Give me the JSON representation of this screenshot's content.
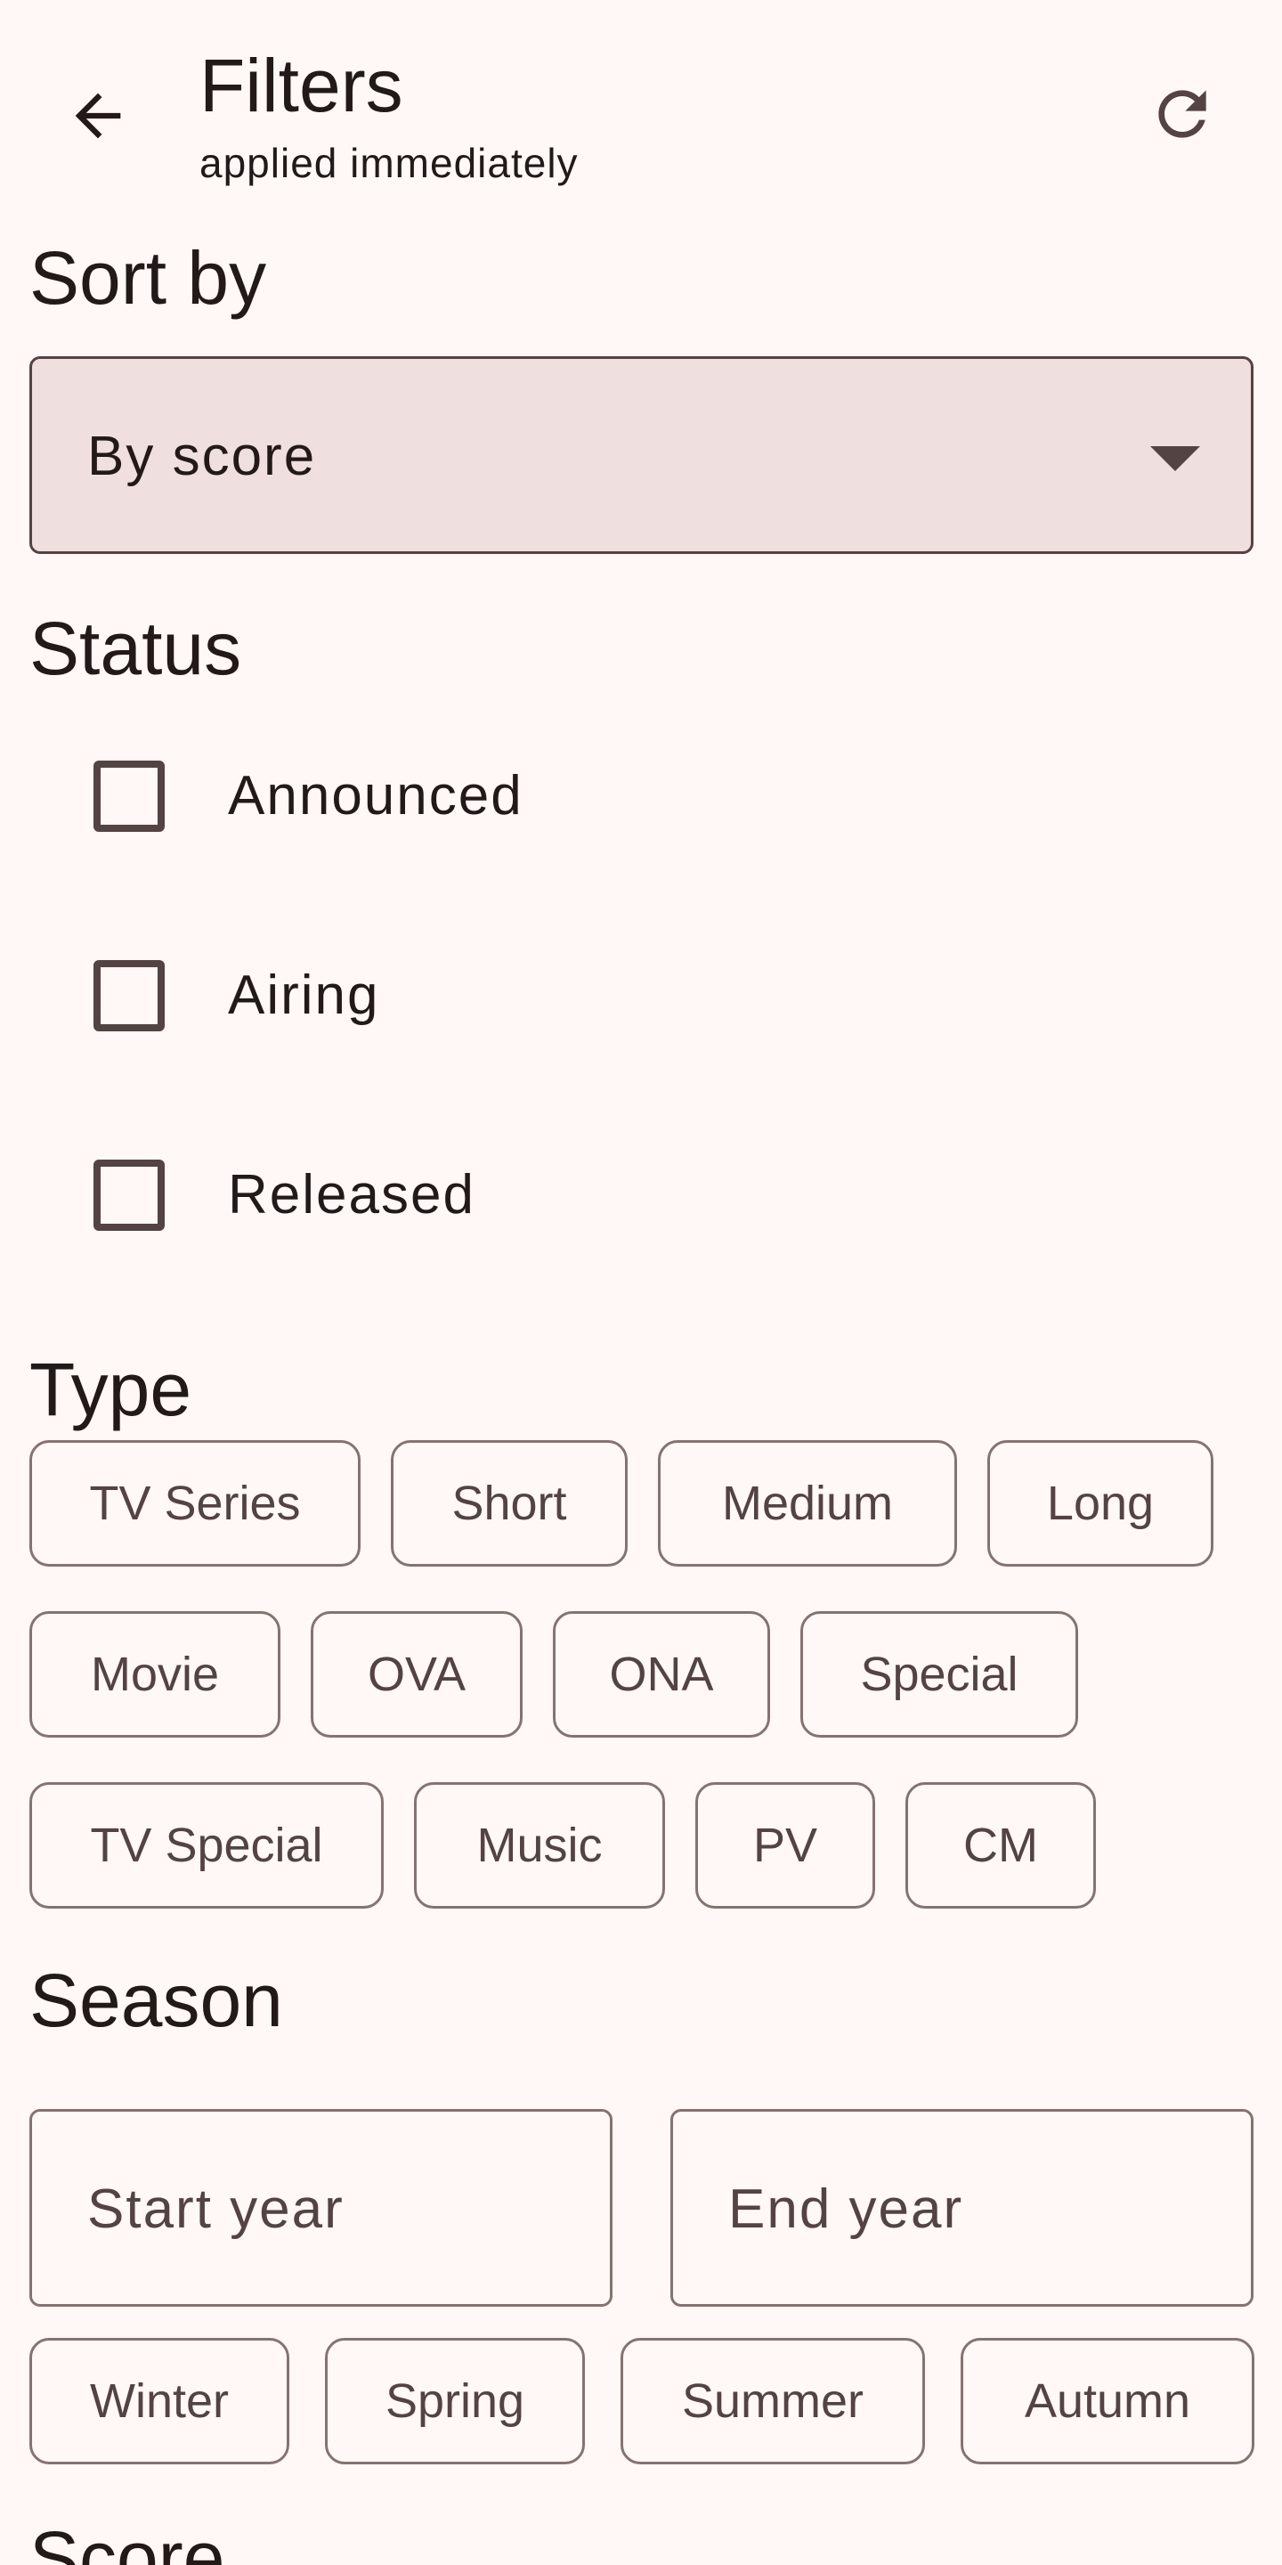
{
  "header": {
    "title": "Filters",
    "subtitle": "applied immediately"
  },
  "sort": {
    "title": "Sort by",
    "selected": "By score"
  },
  "status": {
    "title": "Status",
    "options": [
      {
        "label": "Announced",
        "checked": false
      },
      {
        "label": "Airing",
        "checked": false
      },
      {
        "label": "Released",
        "checked": false
      }
    ]
  },
  "type": {
    "title": "Type",
    "rows": [
      [
        "TV Series",
        "Short",
        "Medium",
        "Long"
      ],
      [
        "Movie",
        "OVA",
        "ONA",
        "Special"
      ],
      [
        "TV Special",
        "Music",
        "PV",
        "CM"
      ]
    ]
  },
  "season": {
    "title": "Season",
    "start_placeholder": "Start year",
    "end_placeholder": "End year",
    "seasons": [
      "Winter",
      "Spring",
      "Summer",
      "Autumn"
    ]
  },
  "score": {
    "title": "Score"
  },
  "colors": {
    "background": "#fff8f6",
    "dropdown_fill": "#f0dfdf",
    "outline": "#857371",
    "text": "#231918"
  }
}
